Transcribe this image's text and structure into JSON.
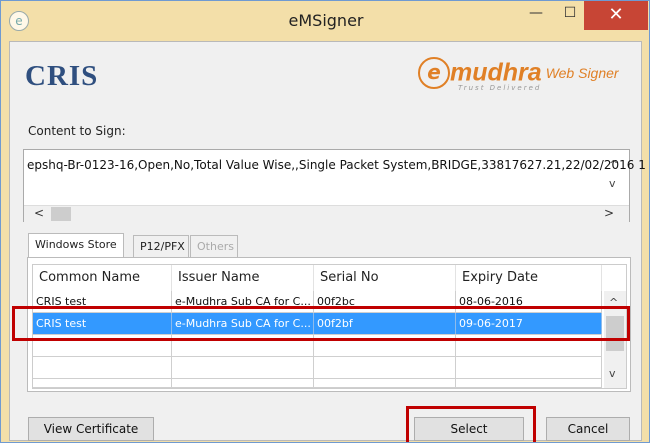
{
  "window": {
    "title": "eMSigner",
    "minimize_glyph": "—",
    "maximize_glyph": "☐",
    "close_glyph": "✕",
    "app_icon_glyph": "e"
  },
  "branding": {
    "cris_logo": "CRIS",
    "emudhra_mark": "e",
    "emudhra_name": "mudhra",
    "web_signer": "Web Signer",
    "tagline": "Trust Delivered"
  },
  "content": {
    "label": "Content to Sign:",
    "text": "epshq-Br-0123-16,Open,No,Total Value Wise,,Single Packet System,BRIDGE,33817627.21,22/02/2016 1",
    "scroll_up": "^",
    "scroll_down": "v",
    "scroll_left": "<",
    "scroll_right": ">"
  },
  "tabs": [
    {
      "label": "Windows Store",
      "active": true,
      "enabled": true
    },
    {
      "label": "P12/PFX",
      "active": false,
      "enabled": true
    },
    {
      "label": "Others",
      "active": false,
      "enabled": false
    }
  ],
  "grid": {
    "columns": [
      "Common Name",
      "Issuer Name",
      "Serial No",
      "Expiry Date"
    ],
    "rows": [
      {
        "common_name": "CRIS test",
        "issuer": "e-Mudhra Sub CA for C...",
        "serial": "00f2bc",
        "expiry": "08-06-2016",
        "selected": false
      },
      {
        "common_name": "CRIS test",
        "issuer": "e-Mudhra Sub CA for C...",
        "serial": "00f2bf",
        "expiry": "09-06-2017",
        "selected": true
      },
      {
        "common_name": "",
        "issuer": "",
        "serial": "",
        "expiry": "",
        "selected": false
      },
      {
        "common_name": "",
        "issuer": "",
        "serial": "",
        "expiry": "",
        "selected": false
      },
      {
        "common_name": "",
        "issuer": "",
        "serial": "",
        "expiry": "",
        "selected": false
      }
    ],
    "scroll_up": "^",
    "scroll_down": "v"
  },
  "buttons": {
    "view_certificate": "View Certificate",
    "select": "Select",
    "cancel": "Cancel"
  },
  "colors": {
    "title_bar": "#f3dfa9",
    "close_button": "#c74535",
    "selection": "#3399ff",
    "highlight_box": "#c00000",
    "brand_orange": "#e08026",
    "cris_blue": "#2f4f7f"
  }
}
